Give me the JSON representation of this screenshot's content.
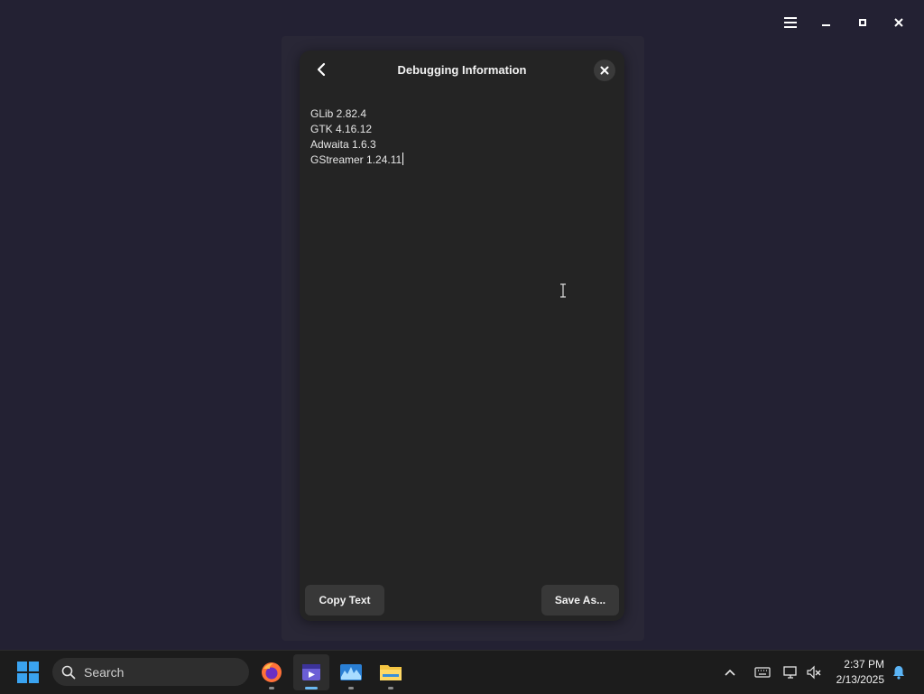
{
  "dialog": {
    "title": "Debugging Information",
    "lines": [
      "GLib 2.82.4",
      "GTK 4.16.12",
      "Adwaita 1.6.3",
      "GStreamer 1.24.11"
    ],
    "copy_label": "Copy Text",
    "save_label": "Save As..."
  },
  "window_controls": {
    "icons": [
      "hamburger-menu-icon",
      "minimize-icon",
      "maximize-icon",
      "close-icon"
    ]
  },
  "taskbar": {
    "search_placeholder": "Search",
    "apps": [
      {
        "name": "firefox",
        "icon": "firefox-icon",
        "active": false
      },
      {
        "name": "video-editor",
        "icon": "video-editor-icon",
        "active": true
      },
      {
        "name": "audio-app",
        "icon": "audio-app-icon",
        "active": false
      },
      {
        "name": "file-explorer",
        "icon": "folder-icon",
        "active": false
      }
    ],
    "time": "2:37 PM",
    "date": "2/13/2025"
  },
  "colors": {
    "desktop": "#232133",
    "dialog_bg": "#242424",
    "button_bg": "#383838",
    "taskbar_bg": "#1c1c1c",
    "accent": "#6ab8f0"
  }
}
